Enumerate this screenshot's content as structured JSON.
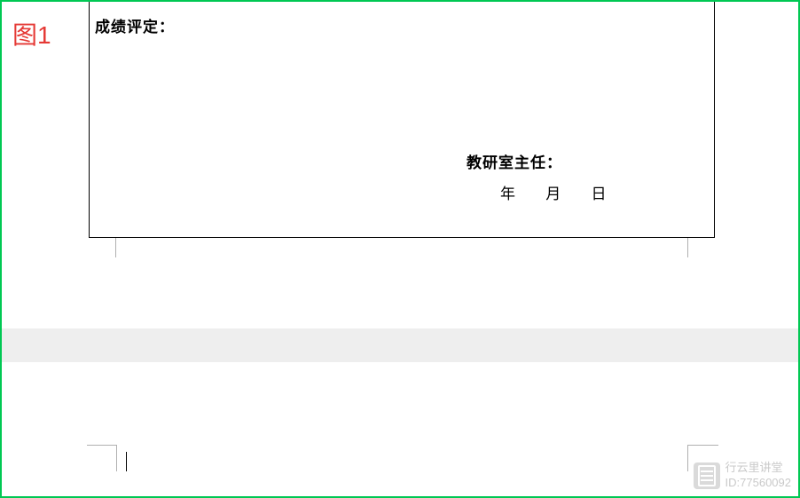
{
  "figure_label": "图1",
  "form": {
    "grade_label": "成绩评定：",
    "dept_head_label": "教研室主任：",
    "date_year": "年",
    "date_month": "月",
    "date_day": "日"
  },
  "watermark": {
    "brand": "行云里讲堂",
    "id_line": "ID:77560092"
  }
}
